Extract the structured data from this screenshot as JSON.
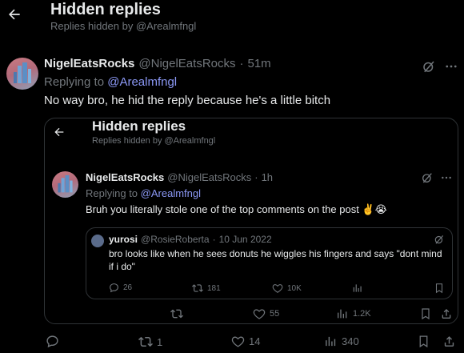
{
  "header": {
    "title": "Hidden replies",
    "subtitle": "Replies hidden by @Arealmfngl"
  },
  "tweet": {
    "display_name": "NigelEatsRocks",
    "handle": "@NigelEatsRocks",
    "separator": "·",
    "time": "51m",
    "replying_prefix": "Replying to",
    "replying_handle": "@Arealmfngl",
    "text": "No way bro, he hid the reply because he's a little bitch",
    "actions": {
      "reposts": "1",
      "likes": "14",
      "views": "340"
    }
  },
  "embedded": {
    "header_title": "Hidden replies",
    "header_subtitle": "Replies hidden by @Arealmfngl",
    "tweet": {
      "display_name": "NigelEatsRocks",
      "handle": "@NigelEatsRocks",
      "separator": "·",
      "time": "1h",
      "replying_prefix": "Replying to",
      "replying_handle": "@Arealmfngl",
      "text": "Bruh you literally stole one of the top comments on the post ✌️😭"
    },
    "quoted": {
      "display_name": "yurosi",
      "handle": "@RosieRoberta",
      "separator": "·",
      "date": "10 Jun 2022",
      "text": "bro looks like when he sees donuts he wiggles his fingers and says \"dont mind if i do\"",
      "actions": {
        "replies": "26",
        "reposts": "181",
        "likes": "10K"
      }
    },
    "actions": {
      "likes": "55",
      "views": "1.2K"
    }
  },
  "colors": {
    "background": "#000000",
    "text": "#e7e9ea",
    "muted": "#71767b",
    "link": "#8b98f5",
    "border": "#2f3336"
  }
}
